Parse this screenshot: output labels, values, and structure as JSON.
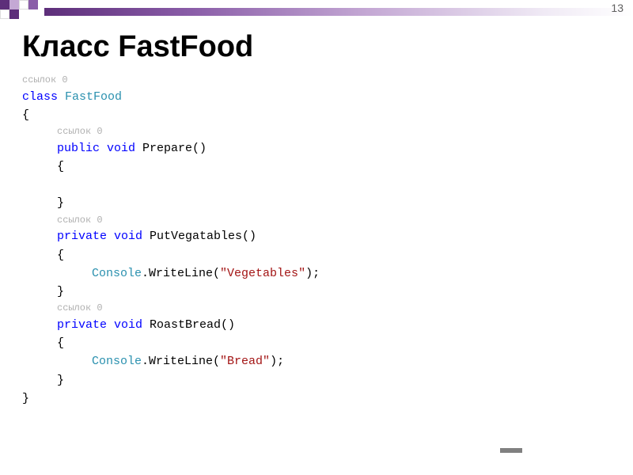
{
  "slide": {
    "number": "13",
    "title": "Класс FastFood"
  },
  "code": {
    "ref0": "ссылок 0",
    "kw_class": "class",
    "classname": " FastFood",
    "lb": "{",
    "rb": "}",
    "kw_public": "public",
    "kw_private": "private",
    "kw_void": " void",
    "m1_name": " Prepare()",
    "m2_name": " PutVegatables()",
    "m2_body_pre": "Console",
    "m2_body_mid": ".WriteLine(",
    "m2_body_str": "\"Vegetables\"",
    "m2_body_end": ");",
    "m3_name": " RoastBread()",
    "m3_body_str": "\"Bread\""
  }
}
